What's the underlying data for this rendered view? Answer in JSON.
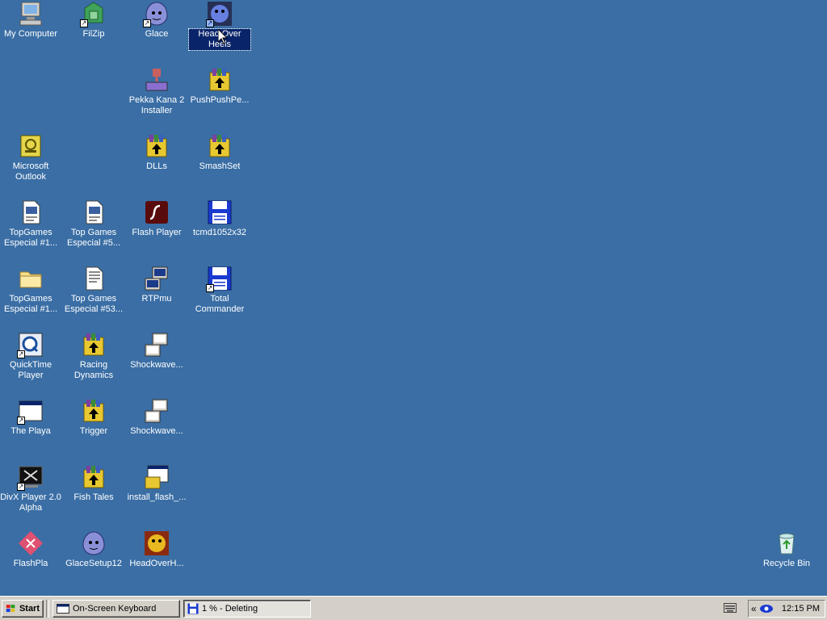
{
  "desktop": {
    "background": "#3a6ea5",
    "icons": [
      {
        "label": "My Computer",
        "icon": "my-computer-icon",
        "shortcut": false
      },
      {
        "label": "FilZip",
        "icon": "filzip-icon",
        "shortcut": true
      },
      {
        "label": "Glace",
        "icon": "glace-icon",
        "shortcut": true
      },
      {
        "label": "Head Over Heels",
        "icon": "head-over-heels-icon",
        "shortcut": true,
        "selected": true
      },
      {
        "label": "Pekka Kana 2 Installer",
        "icon": "installer-icon",
        "shortcut": false
      },
      {
        "label": "PushPushPe...",
        "icon": "winrar-archive-icon",
        "shortcut": false
      },
      {
        "label": "Microsoft Outlook",
        "icon": "outlook-icon",
        "shortcut": false
      },
      {
        "label": "DLLs",
        "icon": "winrar-archive-icon",
        "shortcut": false
      },
      {
        "label": "SmashSet",
        "icon": "winrar-archive-icon",
        "shortcut": false
      },
      {
        "label": "TopGames Especial #1...",
        "icon": "document-icon",
        "shortcut": false
      },
      {
        "label": "Top Games Especial #5...",
        "icon": "document-icon",
        "shortcut": false
      },
      {
        "label": "Flash Player",
        "icon": "flash-player-icon",
        "shortcut": false
      },
      {
        "label": "tcmd1052x32",
        "icon": "floppy-disk-icon",
        "shortcut": false
      },
      {
        "label": "TopGames Especial #1...",
        "icon": "folder-icon",
        "shortcut": false
      },
      {
        "label": "Top Games Especial #53...",
        "icon": "document-icon",
        "shortcut": false
      },
      {
        "label": "RTPmu",
        "icon": "setup-computer-icon",
        "shortcut": false
      },
      {
        "label": "Total Commander",
        "icon": "floppy-disk-icon",
        "shortcut": true
      },
      {
        "label": "QuickTime Player",
        "icon": "quicktime-icon",
        "shortcut": true
      },
      {
        "label": "Racing Dynamics",
        "icon": "winrar-archive-icon",
        "shortcut": false
      },
      {
        "label": "Shockwave...",
        "icon": "setup-computer-icon",
        "shortcut": false
      },
      {
        "label": "The Playa",
        "icon": "application-window-icon",
        "shortcut": true
      },
      {
        "label": "Trigger",
        "icon": "winrar-archive-icon",
        "shortcut": false
      },
      {
        "label": "Shockwave...",
        "icon": "setup-computer-icon",
        "shortcut": false
      },
      {
        "label": "DivX Player 2.0 Alpha",
        "icon": "divx-icon",
        "shortcut": true
      },
      {
        "label": "Fish Tales",
        "icon": "winrar-archive-icon",
        "shortcut": false
      },
      {
        "label": "install_flash_...",
        "icon": "installer-window-icon",
        "shortcut": false
      },
      {
        "label": "FlashPla",
        "icon": "flashpla-icon",
        "shortcut": false
      },
      {
        "label": "GlaceSetup12",
        "icon": "glace-icon",
        "shortcut": false
      },
      {
        "label": "HeadOverH...",
        "icon": "head-over-heels-icon",
        "shortcut": false
      },
      {
        "label": "Recycle Bin",
        "icon": "recycle-bin-icon",
        "shortcut": false
      }
    ]
  },
  "taskbar": {
    "start_label": "Start",
    "tasks": [
      {
        "label": "On-Screen Keyboard",
        "icon": "keyboard-window-icon",
        "active": false
      },
      {
        "label": "1 % - Deleting",
        "icon": "floppy-disk-icon",
        "active": true
      }
    ],
    "tray": {
      "chevron": "«",
      "clock": "12:15 PM"
    }
  }
}
